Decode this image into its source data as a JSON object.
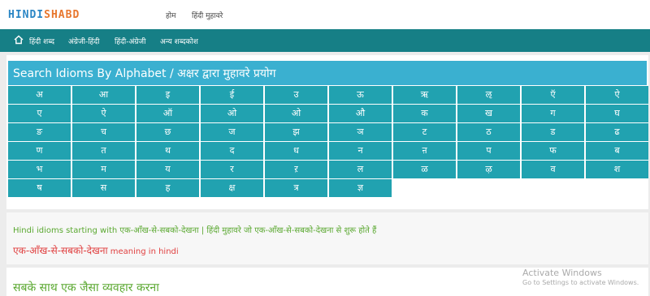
{
  "brand": {
    "part1": "HINDI",
    "part2": "SHABD"
  },
  "top_nav": {
    "home": "होम",
    "idioms": "हिंदी मुहावरे"
  },
  "main_nav": {
    "items": [
      "हिंदी शब्द",
      "अंग्रेजी-हिंदी",
      "हिंदी-अंग्रेजी",
      "अन्य शब्दकोश"
    ]
  },
  "panel": {
    "title": "Search Idioms By Alphabet / अक्षर द्वारा मुहावरे प्रयोग"
  },
  "letters": [
    "अ",
    "आ",
    "इ",
    "ई",
    "उ",
    "ऊ",
    "ऋ",
    "ऌ",
    "ऍ",
    "ऐ",
    "ए",
    "ऐ",
    "ऑ",
    "ओ",
    "ओ",
    "औ",
    "क",
    "ख",
    "ग",
    "घ",
    "ङ",
    "च",
    "छ",
    "ज",
    "झ",
    "ञ",
    "ट",
    "ठ",
    "ड",
    "ढ",
    "ण",
    "त",
    "थ",
    "द",
    "ध",
    "न",
    "ऩ",
    "प",
    "फ",
    "ब",
    "भ",
    "म",
    "य",
    "र",
    "ऱ",
    "ल",
    "ळ",
    "ऴ",
    "व",
    "श",
    "ष",
    "स",
    "ह",
    "क्ष",
    "त्र",
    "ज्ञ"
  ],
  "result": {
    "line1": "Hindi idioms starting with एक-आँख-से-सबको-देखना | हिंदी मुहावरे जो एक-आँख-से-सबको-देखना से शुरू होते हैं",
    "term": "एक-आँख-से-सबको-देखना",
    "meaning_suffix": " meaning in hindi",
    "meaning": "सबके साथ एक जैसा व्यवहार करना"
  },
  "watermark": {
    "title": "Activate Windows",
    "subtitle": "Go to Settings to activate Windows."
  },
  "colors": {
    "nav": "#167f86",
    "panel_header": "#3ab0d0",
    "cell": "#21a2b0",
    "green_text": "#5aa830",
    "red_text": "#e04040"
  }
}
